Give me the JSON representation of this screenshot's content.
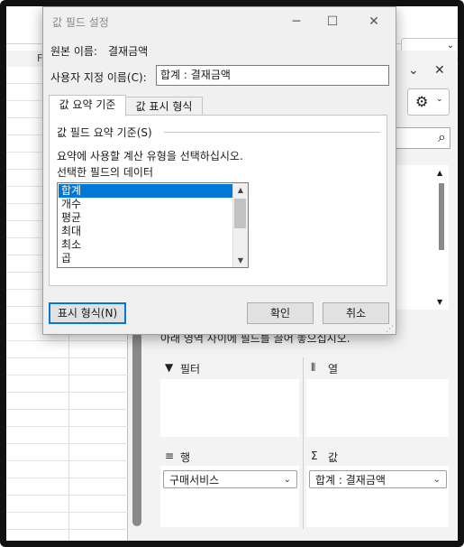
{
  "dialog": {
    "title": "값 필드 설정",
    "min_icon": "─",
    "max_icon": "☐",
    "close_icon": "✕",
    "source_label": "원본 이름:",
    "source_value": "결재금액",
    "custom_label": "사용자 지정 이름(C):",
    "custom_value": "합계 : 결재금액",
    "tabs": [
      {
        "label": "값 요약 기준"
      },
      {
        "label": "값 표시 형식"
      }
    ],
    "section_label": "값 필드 요약 기준(S)",
    "instruction": "요약에 사용할 계산 유형을 선택하십시오.",
    "data_label": "선택한 필드의 데이터",
    "list_items": [
      "합계",
      "개수",
      "평균",
      "최대",
      "최소",
      "곱"
    ],
    "selected_index": 0,
    "number_format_button": "표시 형식(N)",
    "ok_button": "확인",
    "cancel_button": "취소"
  },
  "pane": {
    "close_icon": "✕",
    "settings_icon": "⚙",
    "search_icon": "⌕",
    "drag_hint": "아래 영역 사이에 필드를 끌어 놓으십시오.",
    "zones": {
      "filter": {
        "label": "필터",
        "icon": "▼"
      },
      "column": {
        "label": "열",
        "icon": "⦀"
      },
      "row": {
        "label": "행",
        "icon": "≡",
        "value": "구매서비스"
      },
      "values": {
        "label": "값",
        "icon": "Σ",
        "value": "합계 : 결재금액"
      }
    }
  },
  "sheet": {
    "column_letter": "F"
  }
}
